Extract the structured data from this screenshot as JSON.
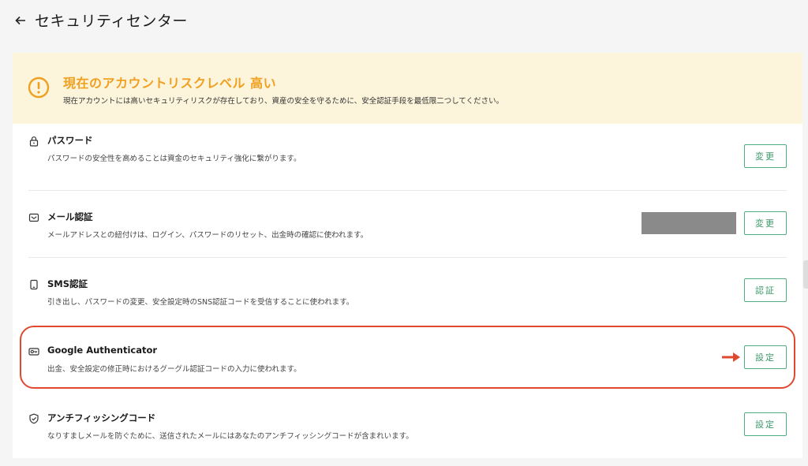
{
  "header": {
    "title": "セキュリティセンター",
    "back_icon": "arrow-left-icon"
  },
  "risk": {
    "title": "現在のアカウントリスクレベル 高い",
    "description": "現在アカウントには高いセキュリティリスクが存在しており、資産の安全を守るために、安全認証手段を最低限二つしてください。",
    "icon": "warning-circle-icon",
    "color": "#f0a020",
    "background": "#fdf4dc"
  },
  "items": [
    {
      "title": "パスワード",
      "description": "パスワードの安全性を高めることは資金のセキュリティ強化に繋がります。",
      "icon": "lock-icon",
      "button": "変更"
    },
    {
      "title": "メール認証",
      "description": "メールアドレスとの紐付けは、ログイン、パスワードのリセット、出金時の確認に使われます。",
      "icon": "mail-icon",
      "button": "変更",
      "masked_value": true
    },
    {
      "title": "SMS認証",
      "description": "引き出し、パスワードの変更、安全設定時のSNS認証コードを受信することに使われます。",
      "icon": "phone-icon",
      "button": "認証"
    },
    {
      "title": "Google Authenticator",
      "description": "出金、安全設定の修正時におけるグーグル認証コードの入力に使われます。",
      "icon": "key-icon",
      "button": "設定",
      "highlighted": true
    },
    {
      "title": "アンチフィッシングコード",
      "description": "なりすましメールを防ぐために、送信されたメールにはあなたのアンチフィッシングコードが含まれいます。",
      "icon": "shield-check-icon",
      "button": "設定"
    }
  ],
  "colors": {
    "accent_green": "#3d9a68",
    "highlight_red": "#e0492f"
  }
}
